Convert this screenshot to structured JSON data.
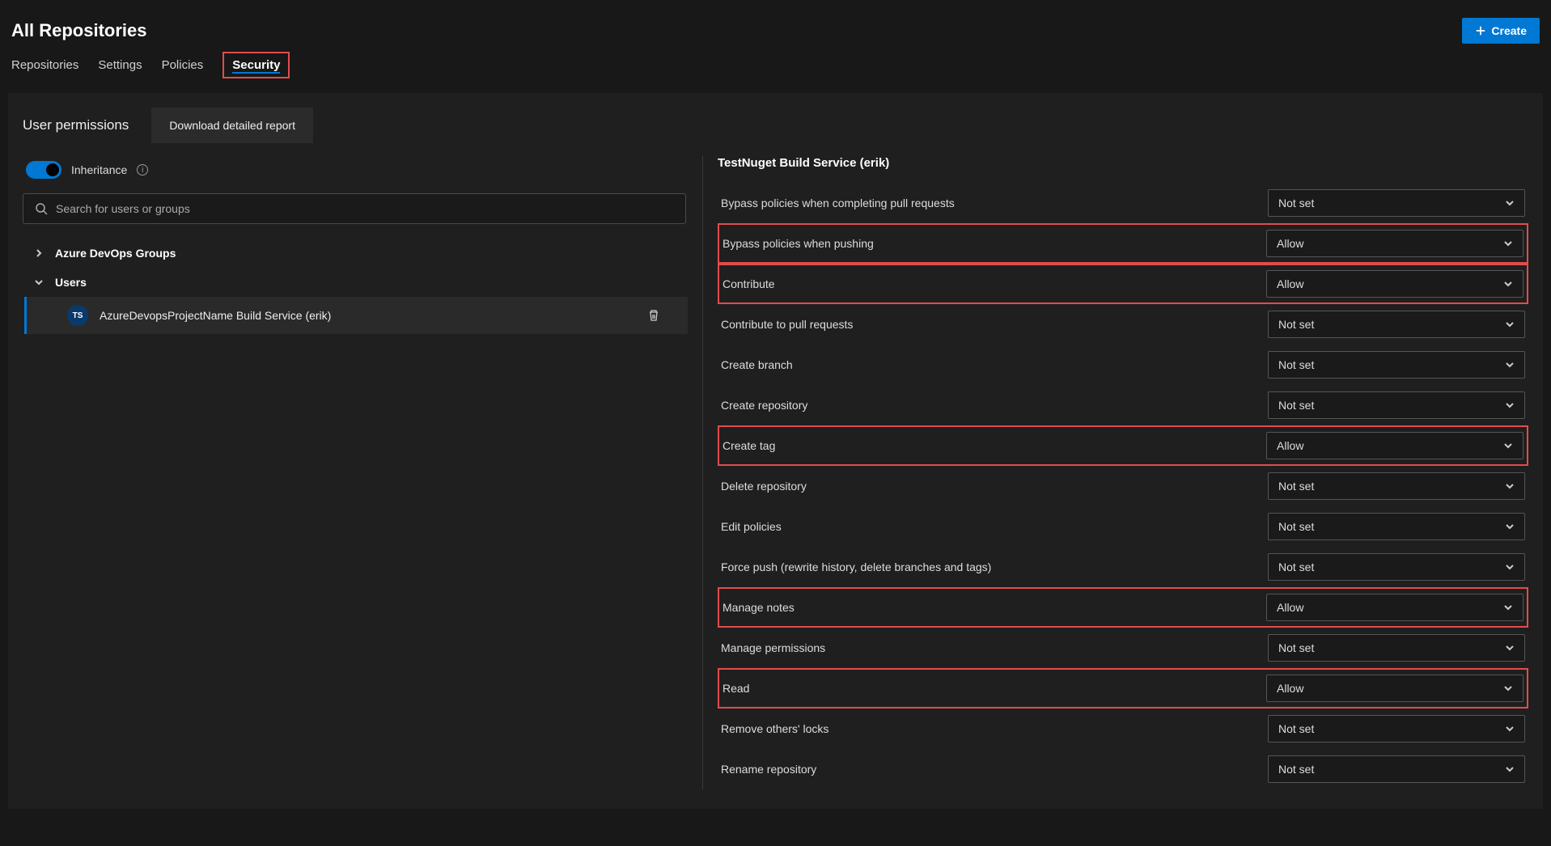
{
  "header": {
    "title": "All Repositories",
    "create_label": "Create"
  },
  "tabs": [
    {
      "label": "Repositories",
      "active": false,
      "highlight": false
    },
    {
      "label": "Settings",
      "active": false,
      "highlight": false
    },
    {
      "label": "Policies",
      "active": false,
      "highlight": false
    },
    {
      "label": "Security",
      "active": true,
      "highlight": true
    }
  ],
  "left": {
    "section_title": "User permissions",
    "download_label": "Download detailed report",
    "inheritance_label": "Inheritance",
    "search_placeholder": "Search for users or groups",
    "groups_header": "Azure DevOps Groups",
    "users_header": "Users",
    "selected_user": {
      "avatar_initials": "TS",
      "name": "AzureDevopsProjectName Build Service (erik)"
    }
  },
  "right": {
    "principal": "TestNuget Build Service (erik)",
    "permissions": [
      {
        "label": "Bypass policies when completing pull requests",
        "value": "Not set",
        "highlight": false
      },
      {
        "label": "Bypass policies when pushing",
        "value": "Allow",
        "highlight": true
      },
      {
        "label": "Contribute",
        "value": "Allow",
        "highlight": true
      },
      {
        "label": "Contribute to pull requests",
        "value": "Not set",
        "highlight": false
      },
      {
        "label": "Create branch",
        "value": "Not set",
        "highlight": false
      },
      {
        "label": "Create repository",
        "value": "Not set",
        "highlight": false
      },
      {
        "label": "Create tag",
        "value": "Allow",
        "highlight": true
      },
      {
        "label": "Delete repository",
        "value": "Not set",
        "highlight": false
      },
      {
        "label": "Edit policies",
        "value": "Not set",
        "highlight": false
      },
      {
        "label": "Force push (rewrite history, delete branches and tags)",
        "value": "Not set",
        "highlight": false
      },
      {
        "label": "Manage notes",
        "value": "Allow",
        "highlight": true
      },
      {
        "label": "Manage permissions",
        "value": "Not set",
        "highlight": false
      },
      {
        "label": "Read",
        "value": "Allow",
        "highlight": true
      },
      {
        "label": "Remove others' locks",
        "value": "Not set",
        "highlight": false
      },
      {
        "label": "Rename repository",
        "value": "Not set",
        "highlight": false
      }
    ]
  }
}
